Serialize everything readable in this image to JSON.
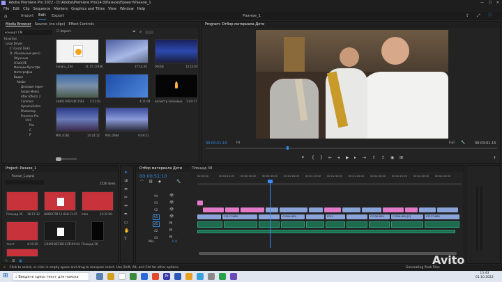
{
  "title": "Adobe Premiere Pro 2022 - D:\\Adobe\\Premiere Pro\\14.0\\Разное\\Проект\\Разное_1",
  "menu": [
    "File",
    "Edit",
    "Clip",
    "Sequence",
    "Markers",
    "Graphics and Titles",
    "View",
    "Window",
    "Help"
  ],
  "workspace": {
    "tabs": [
      "Import",
      "Edit",
      "Export"
    ],
    "center": "Разное_1"
  },
  "media_browser": {
    "tabs": [
      "Media Browser",
      "Source: (no clips)",
      "Effect Controls"
    ],
    "dropdown": "концерт СМ",
    "import_label": "Import",
    "tree": [
      "Favorites",
      "Local Drives",
      "C: (Local Disk)",
      "D: (Локальный диск)",
      "Обучение",
      "ОЗаО(ЛЕ",
      "Фильмы Мультфи",
      "Фотографии",
      "Видео",
      "Adobe",
      "Деловые перег",
      "Adobe Media",
      "After Effects 2",
      "Common",
      "dynamiclinkm",
      "Photoshop",
      "Premiere Pro",
      "14.0",
      "Раз",
      "С",
      "Р"
    ],
    "thumbs": [
      {
        "name": "Запись_234",
        "dur": "11:15:17446"
      },
      {
        "name": "",
        "dur": "17:14:20"
      },
      {
        "name": "00018",
        "dur": "14:13:02"
      },
      {
        "name": "1840116621BC1561",
        "dur": "3:11:03"
      },
      {
        "name": "",
        "dur": "4:11:04"
      },
      {
        "name": "иллюстр ясеновые",
        "dur": "1:40:17"
      },
      {
        "name": "MVI_0181",
        "dur": "14:24:12"
      },
      {
        "name": "MVI_0084",
        "dur": "9:39:21"
      }
    ]
  },
  "program": {
    "title": "Program: Отбор материала Дети",
    "timecode": "00:00:51:10",
    "fit": "Fit",
    "quality": "Full",
    "end_timecode": "00:03:01:15"
  },
  "project": {
    "title": "Project: Разное_1",
    "path": "Разное_1.prproj",
    "count": "1526 items",
    "items": [
      {
        "name": "Площад 35",
        "dur": "18:12:32"
      },
      {
        "name": "НОВОСТИ 11.0…",
        "dur": "18:11:15"
      },
      {
        "name": "Intro",
        "dur": "13:22:00"
      },
      {
        "name": "текст",
        "dur": "4:10:20"
      },
      {
        "name": "1/4001BS21B1521",
        "dur": "5:00:04"
      },
      {
        "name": "Площад 38",
        "dur": "20:3:21"
      },
      {
        "name": "",
        "dur": ""
      }
    ]
  },
  "timeline": {
    "tabs": [
      "Отбор материала Дети",
      "Площад 38"
    ],
    "timecode": "00:00:51:10",
    "ruler": [
      "00:00:00",
      "00:00:15:00",
      "00:00:30:00",
      "00:00:45:00",
      "00:01:00:00",
      "00:01:15:00",
      "00:01:30:00",
      "00:01:45:00",
      "00:02:00:00",
      "00:02:15:00",
      "00:02:30:00",
      "00:02:45:00"
    ],
    "tracks": [
      "V4",
      "V3",
      "V2",
      "V1",
      "A1",
      "A2",
      "A3"
    ],
    "mix": "Mix",
    "mix_value": "0.0",
    "clip_labels": [
      "C2117.MP4",
      "C0304.MP4",
      "C011",
      "C2226.MP4",
      "C2226.MP4 [V]",
      "C2137.MP4"
    ]
  },
  "status": {
    "hint": "Click to select, or click in empty space and drag to marquee select. Use Shift, Alt, and Ctrl for other options.",
    "right": "Generating Peak Files"
  },
  "taskbar": {
    "search": "Введите здесь текст для поиска",
    "time": "15:43",
    "date": "01.10.2022",
    "watermark": "Avito"
  },
  "colors": {
    "accent": "#2d8ceb",
    "pink_clip": "#e27ac8",
    "blue_clip": "#8aa3d8",
    "audio": "#1f6b4e",
    "playhead": "#3b8bff"
  }
}
